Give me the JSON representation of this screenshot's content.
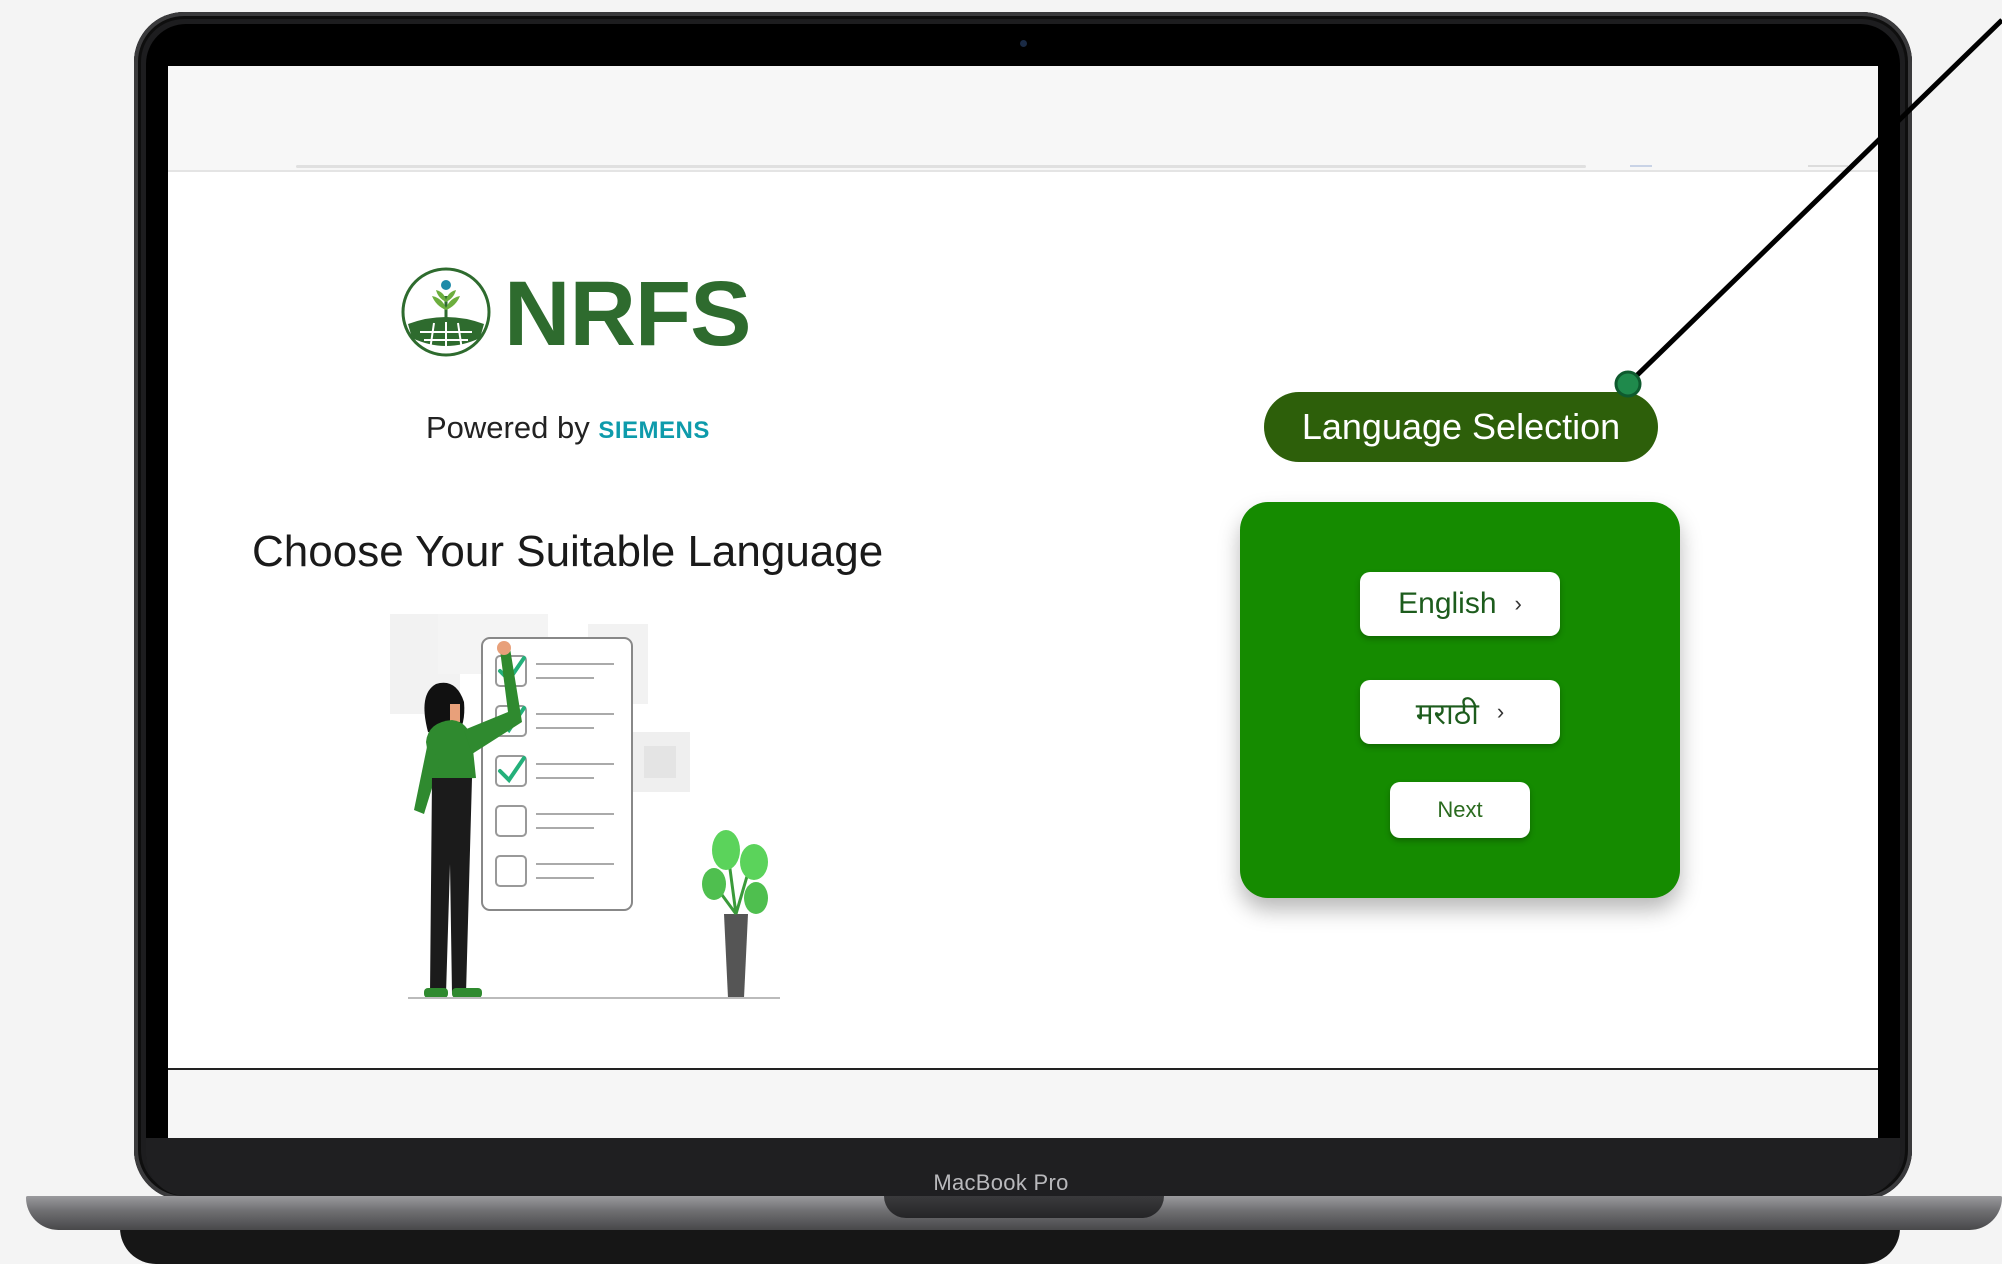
{
  "device": {
    "label": "MacBook Pro"
  },
  "app": {
    "logo_text": "NRFS",
    "powered_prefix": "Powered by",
    "powered_brand": "SIEMENS",
    "headline": "Choose Your Suitable Language"
  },
  "language_panel": {
    "pill_label": "Language Selection",
    "options": [
      {
        "label": "English",
        "chevron": "›"
      },
      {
        "label": "मराठी",
        "chevron": "›"
      }
    ],
    "next_label": "Next"
  },
  "colors": {
    "brand_green": "#2e6b2e",
    "pill_green": "#2d5f0a",
    "card_green": "#158b00",
    "siemens_teal": "#0e9bab"
  },
  "icons": [
    "nrfs-logo-icon",
    "chevron-right-icon",
    "checklist-illustration",
    "callout-dot-icon"
  ]
}
